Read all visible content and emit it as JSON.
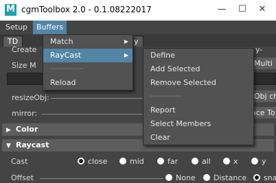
{
  "window": {
    "title": "cgmToolbox 2.0 - 0.1.08222017",
    "minimize_glyph": "—",
    "maximize_glyph": "☐",
    "close_glyph": "✕",
    "icon": "maya-app-icon"
  },
  "menubar": {
    "items": [
      "Setup",
      "Buffers"
    ]
  },
  "tabs": {
    "active": "TD",
    "partial": "y"
  },
  "panel": {
    "create_label": "Create",
    "size_label": "Size M",
    "resize_label": "resizeObj:",
    "mirror_label": "mirror:",
    "right_y_label": "y-",
    "multi_button": "Multi",
    "obj_button": "Obj ch",
    "place_button": "ace To"
  },
  "sections": {
    "color": "Color",
    "raycast": "Raycast"
  },
  "raycast": {
    "cast_label": "Cast",
    "cast_options": [
      "close",
      "mid",
      "far",
      "all",
      "x",
      "y"
    ],
    "cast_selected": "close",
    "offset_label": "Offset",
    "offset_options": [
      "None",
      "Distance",
      "sna"
    ],
    "offset_selected": "sna"
  },
  "buffers_menu": {
    "items": [
      {
        "label": "Match",
        "submenu": true
      },
      {
        "label": "RayCast",
        "submenu": true,
        "active": true
      },
      {
        "label": "-------------",
        "separator": true
      },
      {
        "label": "Reload"
      }
    ]
  },
  "raycast_menu": {
    "items": [
      {
        "label": "Define"
      },
      {
        "label": "Add Selected"
      },
      {
        "label": "Remove Selected"
      },
      {
        "label": "-------------",
        "separator": true
      },
      {
        "label": "Report"
      },
      {
        "label": "Select Members"
      },
      {
        "label": "Clear"
      }
    ]
  }
}
